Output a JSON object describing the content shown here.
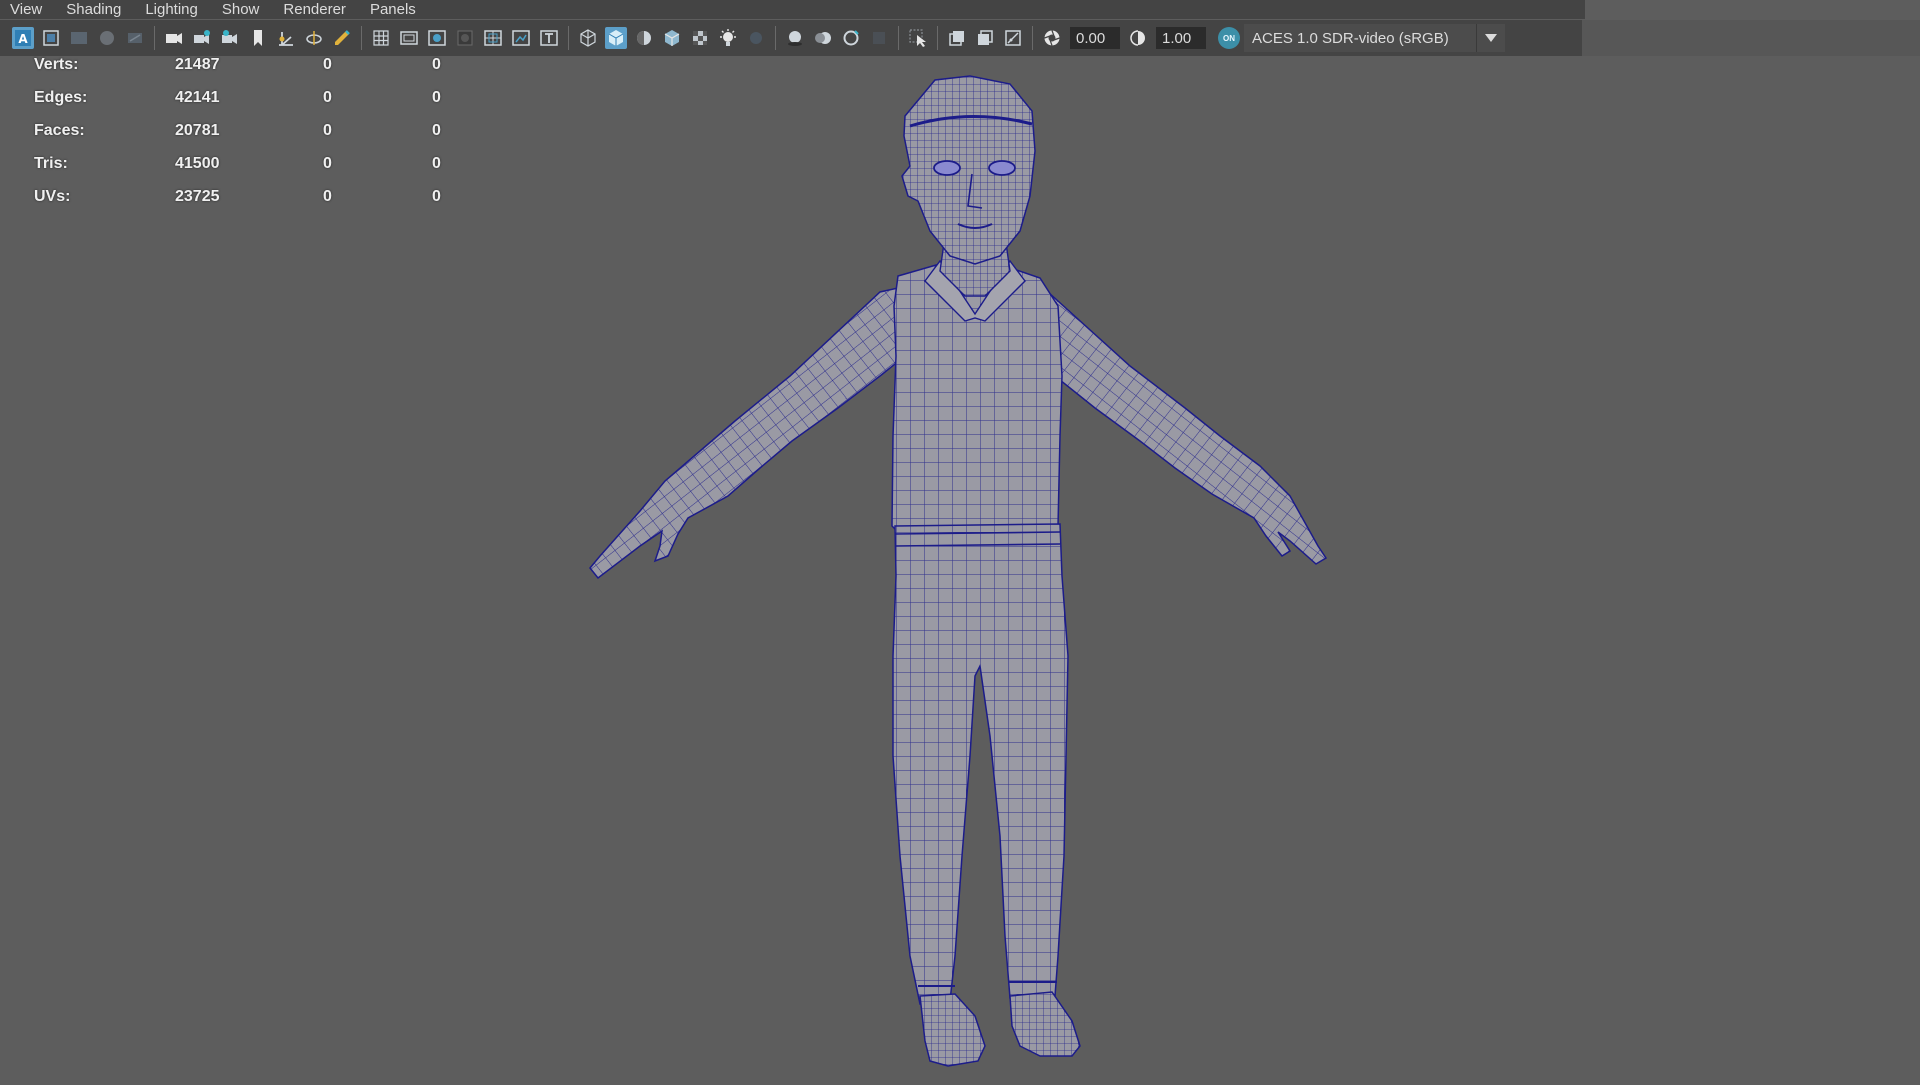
{
  "menubar": {
    "items": [
      "View",
      "Shading",
      "Lighting",
      "Show",
      "Renderer",
      "Panels"
    ]
  },
  "toolbar": {
    "exposure_value": "0.00",
    "gamma_value": "1.00",
    "colorspace_badge": "ON",
    "colorspace_label": "ACES 1.0 SDR-video (sRGB)",
    "icons": [
      "select-camera-icon",
      "camera-attributes-icon",
      "bookmark-icon",
      "image-plane-icon",
      "2d-pan-zoom-icon",
      "grease-pencil-icon",
      "camera-icon",
      "camera-lock-icon",
      "film-gate-icon",
      "resolution-gate-icon",
      "gate-mask-icon",
      "field-chart-icon",
      "safe-action-icon",
      "safe-title-icon",
      "wireframe-icon",
      "smooth-shade-icon",
      "default-material-icon",
      "wireframe-on-shaded-icon",
      "textured-icon",
      "use-lights-icon",
      "shadows-icon",
      "screen-space-ao-icon",
      "motion-blur-icon",
      "anti-aliasing-icon",
      "depth-of-field-icon",
      "isolate-select-icon",
      "xray-icon",
      "xray-active-icon",
      "xray-joints-icon",
      "exposure-icon",
      "gamma-icon"
    ],
    "accent_color": "#5c9fc9"
  },
  "hud": {
    "rows": [
      {
        "label": "Verts:",
        "v1": "21487",
        "v2": "0",
        "v3": "0"
      },
      {
        "label": "Edges:",
        "v1": "42141",
        "v2": "0",
        "v3": "0"
      },
      {
        "label": "Faces:",
        "v1": "20781",
        "v2": "0",
        "v3": "0"
      },
      {
        "label": "Tris:",
        "v1": "41500",
        "v2": "0",
        "v3": "0"
      },
      {
        "label": "UVs:",
        "v1": "23725",
        "v2": "0",
        "v3": "0"
      }
    ]
  },
  "viewport": {
    "background_color": "#5d5d5d",
    "model_fill_color": "#9a9aa4",
    "wire_color": "#1c1c8a",
    "subject": "character-model"
  }
}
